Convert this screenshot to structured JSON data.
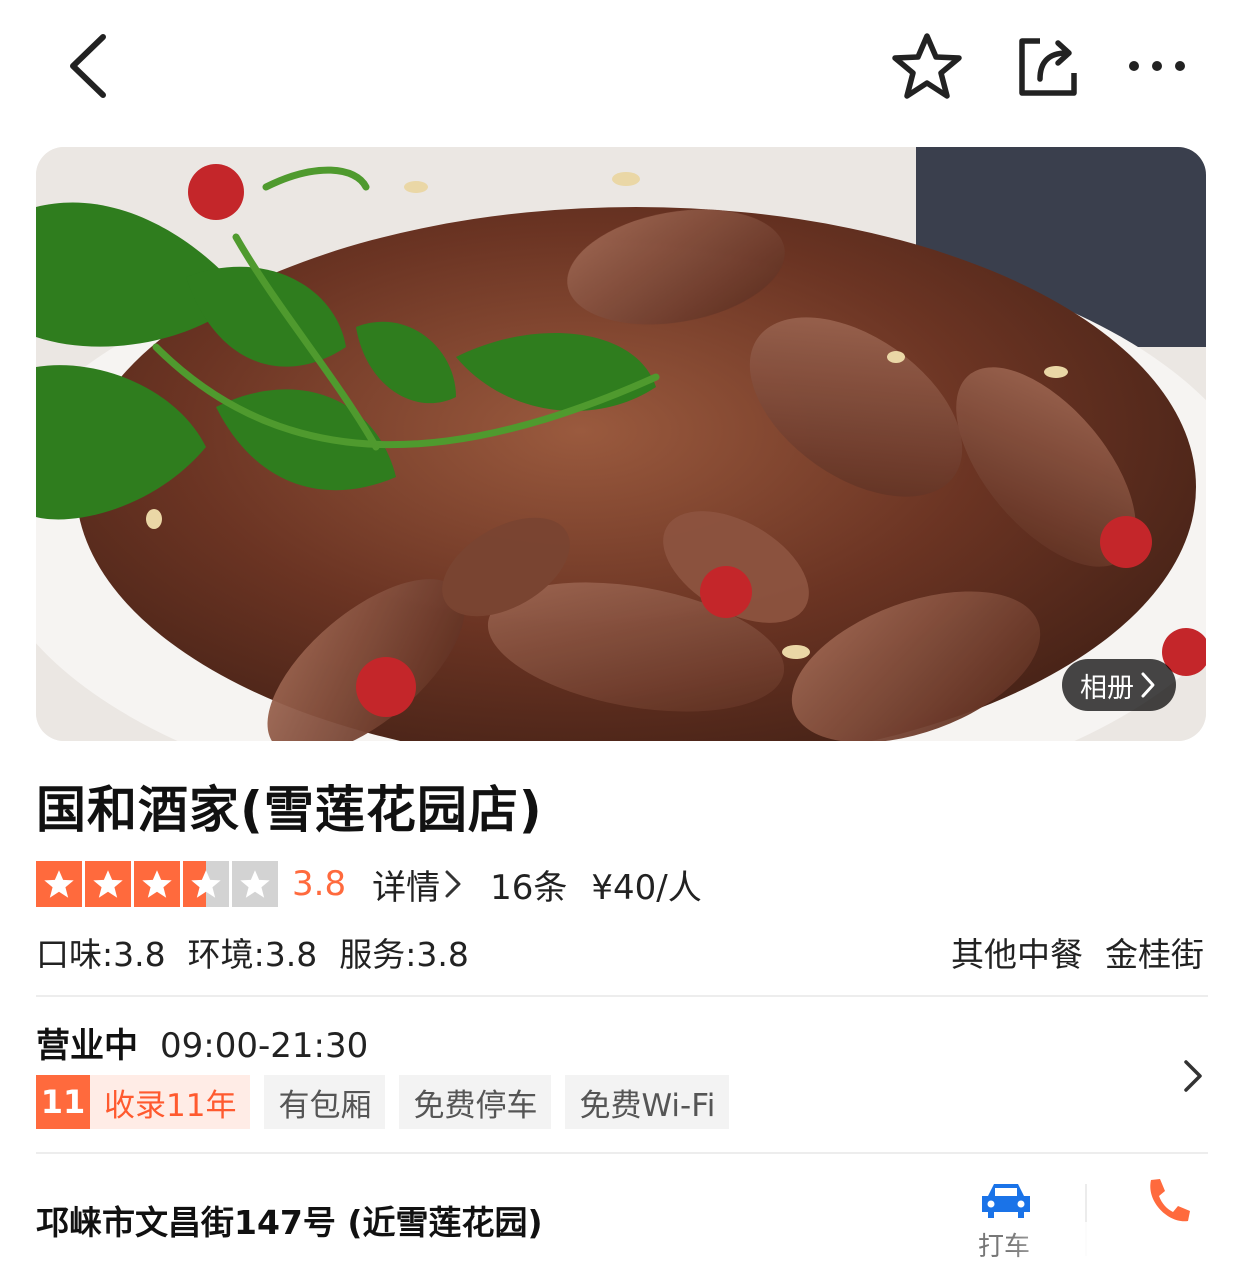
{
  "header": {
    "back_icon": "chevron-left-icon",
    "favorite_icon": "star-outline-icon",
    "share_icon": "share-icon",
    "more_icon": "more-dots-icon"
  },
  "hero": {
    "album_label": "相册"
  },
  "shop": {
    "name": "国和酒家(雪莲花园店)",
    "rating": 3.8,
    "rating_text": "3.8",
    "stars_max": 5,
    "detail_label": "详情",
    "review_count": "16条",
    "avg_price": "¥40/人",
    "subscores": [
      "口味:3.8",
      "环境:3.8",
      "服务:3.8"
    ],
    "categories": [
      "其他中餐",
      "金桂街"
    ]
  },
  "hours": {
    "status": "营业中",
    "time": "09:00-21:30"
  },
  "tags": {
    "years_num": "11",
    "years_text": "收录11年",
    "items": [
      "有包厢",
      "免费停车",
      "免费Wi-Fi"
    ]
  },
  "address": {
    "text": "邛崃市文昌街147号 (近雪莲花园)",
    "taxi_label": "打车",
    "taxi_icon": "car-icon",
    "phone_icon": "phone-icon"
  },
  "colors": {
    "accent": "#ff6a3d",
    "taxi_blue": "#1a73e8"
  }
}
